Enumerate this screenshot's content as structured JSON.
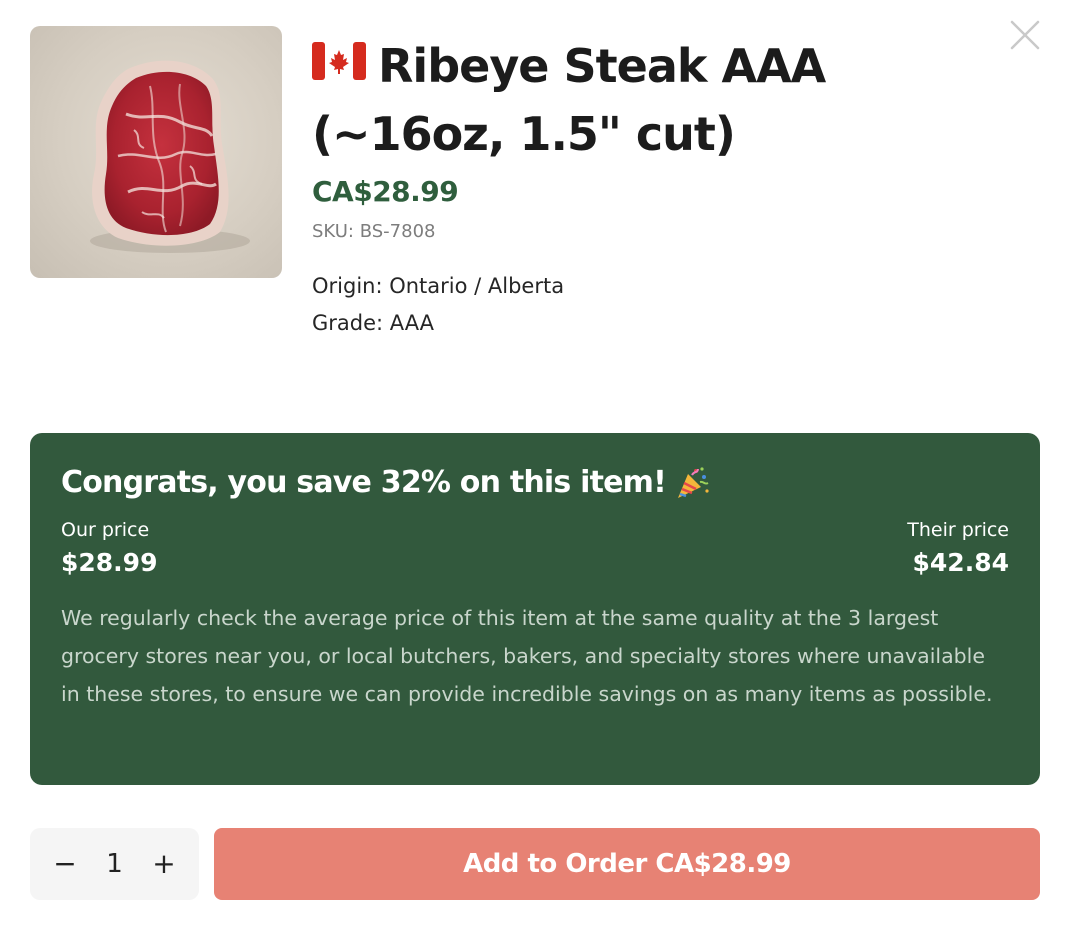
{
  "product": {
    "title": "Ribeye Steak AAA (~16oz, 1.5\" cut)",
    "price": "CA$28.99",
    "sku": "SKU: BS-7808",
    "origin": "Origin: Ontario / Alberta",
    "grade": "Grade: AAA",
    "flag_icon": "canada-flag-icon"
  },
  "savings": {
    "headline": "Congrats, you save 32% on this item!",
    "headline_icon": "party-popper-icon",
    "our_price_label": "Our price",
    "our_price": "$28.99",
    "their_price_label": "Their price",
    "their_price": "$42.84",
    "description": "We regularly check the average price of this item at the same quality at the 3 largest grocery stores near you, or local butchers, bakers, and specialty stores where unavailable in these stores, to ensure we can provide incredible savings on as many items as possible."
  },
  "order": {
    "quantity": "1",
    "decrement": "−",
    "increment": "+",
    "add_button_label": "Add to Order CA$28.99"
  },
  "colors": {
    "accent_green": "#32593d",
    "price_green": "#2f5e3d",
    "add_button": "#e78274"
  }
}
